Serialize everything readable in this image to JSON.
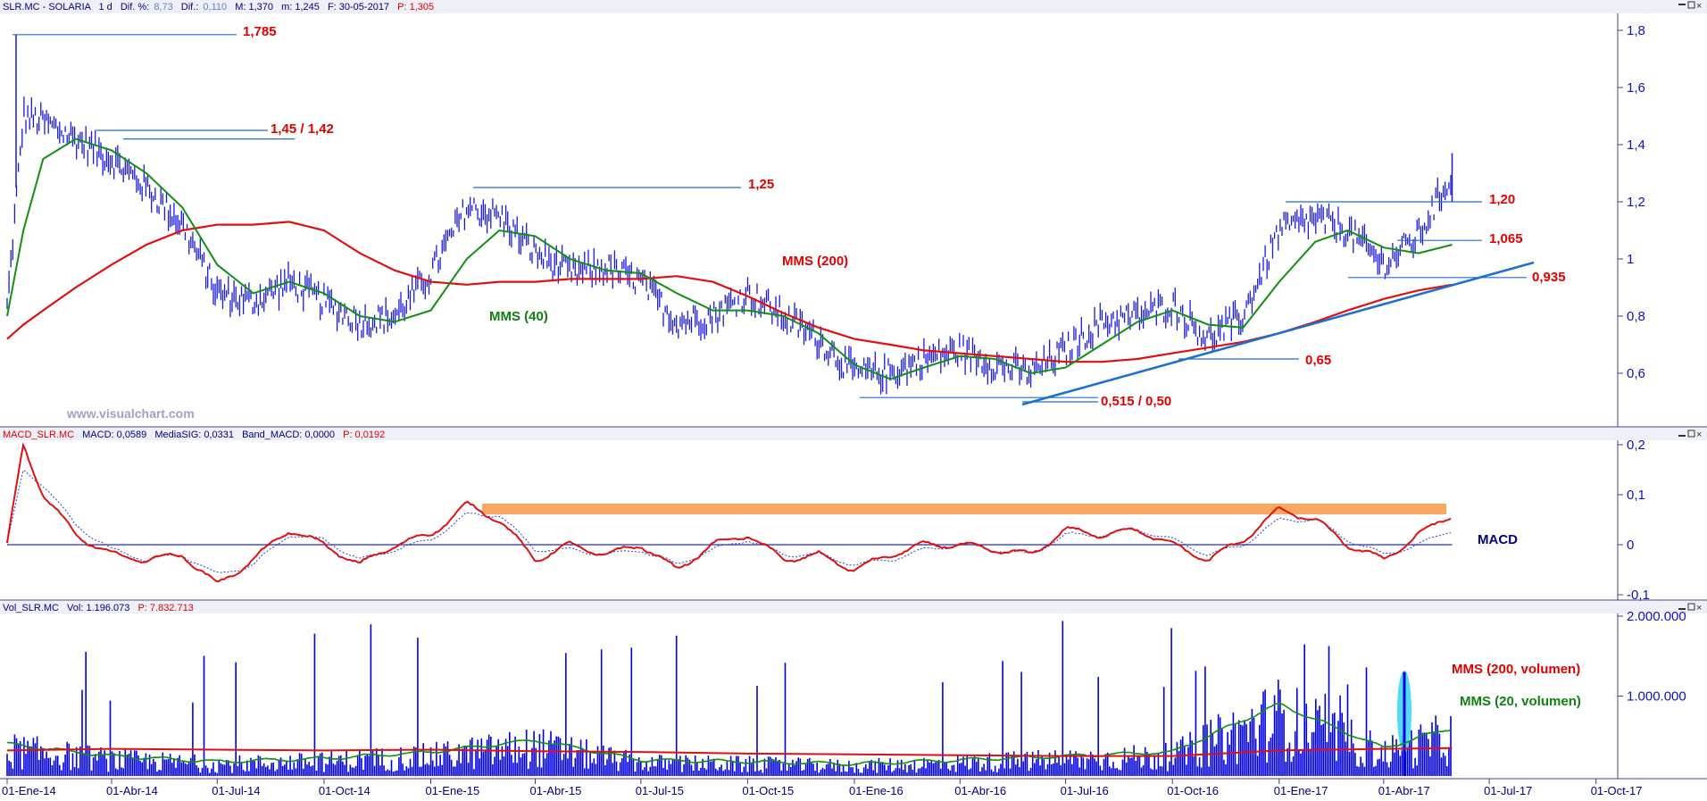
{
  "price_panel": {
    "header": {
      "symbol": "SLR.MC - SOLARIA",
      "period": "1 d",
      "dif_pct_label": "Dif. %:",
      "dif_pct": "8,73",
      "dif_label": "Dif.:",
      "dif": "0,110",
      "max": "M: 1,370",
      "min": "m: 1,245",
      "date": "F: 30-05-2017",
      "close": "P: 1,305"
    },
    "watermark": "www.visualchart.com",
    "annotations": {
      "high_1785": "1,785",
      "level_145": "1,45 / 1,42",
      "level_125": "1,25",
      "level_120": "1,20",
      "level_1065": "1,065",
      "level_0935": "0,935",
      "level_065": "0,65",
      "level_0515": "0,515 / 0,50",
      "mms200": "MMS (200)",
      "mms40": "MMS (40)"
    },
    "y_ticks": [
      "1,8",
      "1,6",
      "1,4",
      "1,2",
      "1",
      "0,8",
      "0,6"
    ]
  },
  "macd_panel": {
    "header": {
      "name": "MACD_SLR.MC",
      "macd": "MACD: 0,0589",
      "signal": "MediaSIG: 0,0331",
      "band": "Band_MACD: 0,0000",
      "p": "P: 0,0192"
    },
    "label": "MACD",
    "y_ticks": [
      "0,2",
      "0,1",
      "0",
      "-0,1"
    ]
  },
  "volume_panel": {
    "header": {
      "name": "Vol_SLR.MC",
      "vol": "Vol: 1.196.073",
      "p": "P: 7.832.713"
    },
    "legend_200": "MMS (200, volumen)",
    "legend_20": "MMS (20, volumen)",
    "y_ticks": [
      "2.000.000",
      "1.000.000"
    ]
  },
  "x_ticks": [
    "01-Ene-14",
    "01-Abr-14",
    "01-Jul-14",
    "01-Oct-14",
    "01-Ene-15",
    "01-Abr-15",
    "01-Jul-15",
    "01-Oct-15",
    "01-Ene-16",
    "01-Abr-16",
    "01-Jul-16",
    "01-Oct-16",
    "01-Ene-17",
    "01-Abr-17",
    "01-Jul-17",
    "01-Oct-17"
  ],
  "colors": {
    "price": "#1a1ad8",
    "mms40": "#109010",
    "mms200": "#e01010",
    "trendline": "#1a6fd0",
    "macd_band": "#f8a860",
    "volume": "#0000e0",
    "highlight": "#40d8f0"
  },
  "chart_data": [
    {
      "type": "line",
      "title": "SLR.MC - SOLARIA",
      "ylim": [
        0.47,
        1.88
      ],
      "x": [
        "2014-01-01",
        "2014-01-15",
        "2014-02-01",
        "2014-03-01",
        "2014-04-01",
        "2014-05-01",
        "2014-06-01",
        "2014-07-01",
        "2014-08-01",
        "2014-09-01",
        "2014-10-01",
        "2014-11-01",
        "2014-12-01",
        "2015-01-01",
        "2015-02-01",
        "2015-03-01",
        "2015-04-01",
        "2015-05-01",
        "2015-06-01",
        "2015-07-01",
        "2015-08-01",
        "2015-09-01",
        "2015-10-01",
        "2015-11-01",
        "2015-12-01",
        "2016-01-01",
        "2016-02-01",
        "2016-03-01",
        "2016-04-01",
        "2016-05-01",
        "2016-06-01",
        "2016-07-01",
        "2016-08-01",
        "2016-09-01",
        "2016-10-01",
        "2016-11-01",
        "2016-12-01",
        "2017-01-01",
        "2017-02-01",
        "2017-03-01",
        "2017-04-01",
        "2017-05-01",
        "2017-05-30"
      ],
      "series": [
        {
          "name": "",
          "values": [
            0.83,
            1.5,
            1.48,
            1.42,
            1.35,
            1.25,
            1.12,
            0.88,
            0.85,
            0.92,
            0.85,
            0.78,
            0.8,
            0.95,
            1.18,
            1.15,
            1.02,
            0.95,
            0.97,
            0.92,
            0.78,
            0.8,
            0.88,
            0.8,
            0.72,
            0.6,
            0.6,
            0.65,
            0.68,
            0.63,
            0.6,
            0.68,
            0.78,
            0.8,
            0.84,
            0.72,
            0.8,
            1.1,
            1.14,
            1.1,
            0.98,
            1.08,
            1.3
          ]
        },
        {
          "name": "MMS (40)",
          "values": [
            0.8,
            1.1,
            1.35,
            1.42,
            1.38,
            1.3,
            1.18,
            0.98,
            0.88,
            0.92,
            0.88,
            0.8,
            0.78,
            0.82,
            1.0,
            1.1,
            1.08,
            1.0,
            0.96,
            0.95,
            0.88,
            0.82,
            0.82,
            0.8,
            0.74,
            0.63,
            0.58,
            0.62,
            0.66,
            0.65,
            0.6,
            0.62,
            0.7,
            0.78,
            0.82,
            0.77,
            0.76,
            0.92,
            1.06,
            1.1,
            1.04,
            1.02,
            1.05
          ]
        },
        {
          "name": "MMS (200)",
          "values": [
            0.72,
            0.77,
            0.82,
            0.9,
            0.98,
            1.05,
            1.1,
            1.12,
            1.12,
            1.13,
            1.1,
            1.02,
            0.96,
            0.92,
            0.91,
            0.92,
            0.92,
            0.93,
            0.93,
            0.93,
            0.94,
            0.92,
            0.87,
            0.81,
            0.76,
            0.72,
            0.7,
            0.68,
            0.67,
            0.66,
            0.65,
            0.64,
            0.64,
            0.65,
            0.67,
            0.69,
            0.71,
            0.74,
            0.78,
            0.82,
            0.86,
            0.89,
            0.91
          ]
        }
      ]
    },
    {
      "type": "line",
      "title": "MACD_SLR.MC",
      "ylim": [
        -0.12,
        0.22
      ],
      "x": [
        "2014-01-01",
        "2014-01-15",
        "2014-02-01",
        "2014-03-01",
        "2014-04-01",
        "2014-05-01",
        "2014-06-01",
        "2014-07-01",
        "2014-08-01",
        "2014-09-01",
        "2014-10-01",
        "2014-11-01",
        "2014-12-01",
        "2015-01-01",
        "2015-02-01",
        "2015-03-01",
        "2015-04-01",
        "2015-05-01",
        "2015-06-01",
        "2015-07-01",
        "2015-08-01",
        "2015-09-01",
        "2015-10-01",
        "2015-11-01",
        "2015-12-01",
        "2016-01-01",
        "2016-02-01",
        "2016-03-01",
        "2016-04-01",
        "2016-05-01",
        "2016-06-01",
        "2016-07-01",
        "2016-08-01",
        "2016-09-01",
        "2016-10-01",
        "2016-11-01",
        "2016-12-01",
        "2017-01-01",
        "2017-02-01",
        "2017-03-01",
        "2017-04-01",
        "2017-05-01",
        "2017-05-30"
      ],
      "series": [
        {
          "name": "",
          "values": [
            0.0,
            0.2,
            0.1,
            0.02,
            -0.02,
            -0.03,
            -0.02,
            -0.08,
            -0.03,
            0.03,
            0.0,
            -0.04,
            0.0,
            0.02,
            0.08,
            0.05,
            -0.03,
            0.0,
            -0.02,
            0.0,
            -0.05,
            0.0,
            0.02,
            -0.03,
            -0.02,
            -0.05,
            -0.02,
            0.0,
            0.0,
            -0.01,
            -0.02,
            0.03,
            0.02,
            0.03,
            0.0,
            -0.03,
            0.01,
            0.07,
            0.05,
            0.0,
            -0.03,
            0.02,
            0.06
          ]
        },
        {
          "name": "",
          "values": [
            0.0,
            0.15,
            0.12,
            0.04,
            -0.01,
            -0.03,
            -0.02,
            -0.06,
            -0.04,
            0.02,
            0.01,
            -0.03,
            -0.01,
            0.01,
            0.06,
            0.06,
            -0.01,
            -0.01,
            -0.02,
            -0.01,
            -0.04,
            -0.01,
            0.01,
            -0.02,
            -0.02,
            -0.04,
            -0.03,
            -0.01,
            0.0,
            -0.01,
            -0.02,
            0.02,
            0.02,
            0.03,
            0.01,
            -0.02,
            0.0,
            0.05,
            0.05,
            0.01,
            -0.02,
            0.0,
            0.03
          ]
        }
      ]
    },
    {
      "type": "bar",
      "title": "Vol_SLR.MC",
      "ylim": [
        0,
        2100000
      ],
      "x": [
        "2014-01-01",
        "2014-04-01",
        "2014-07-01",
        "2014-10-01",
        "2015-01-01",
        "2015-04-01",
        "2015-07-01",
        "2015-10-01",
        "2016-01-01",
        "2016-04-01",
        "2016-07-01",
        "2016-10-01",
        "2017-01-01",
        "2017-04-01",
        "2017-05-30"
      ],
      "series": [
        {
          "name": "MMS (200, volumen)",
          "values": [
            320000,
            340000,
            330000,
            320000,
            330000,
            310000,
            300000,
            280000,
            270000,
            260000,
            250000,
            250000,
            320000,
            340000,
            350000
          ]
        },
        {
          "name": "MMS (20, volumen)",
          "values": [
            400000,
            250000,
            180000,
            220000,
            300000,
            450000,
            200000,
            180000,
            150000,
            200000,
            250000,
            300000,
            900000,
            350000,
            600000
          ]
        }
      ]
    }
  ]
}
